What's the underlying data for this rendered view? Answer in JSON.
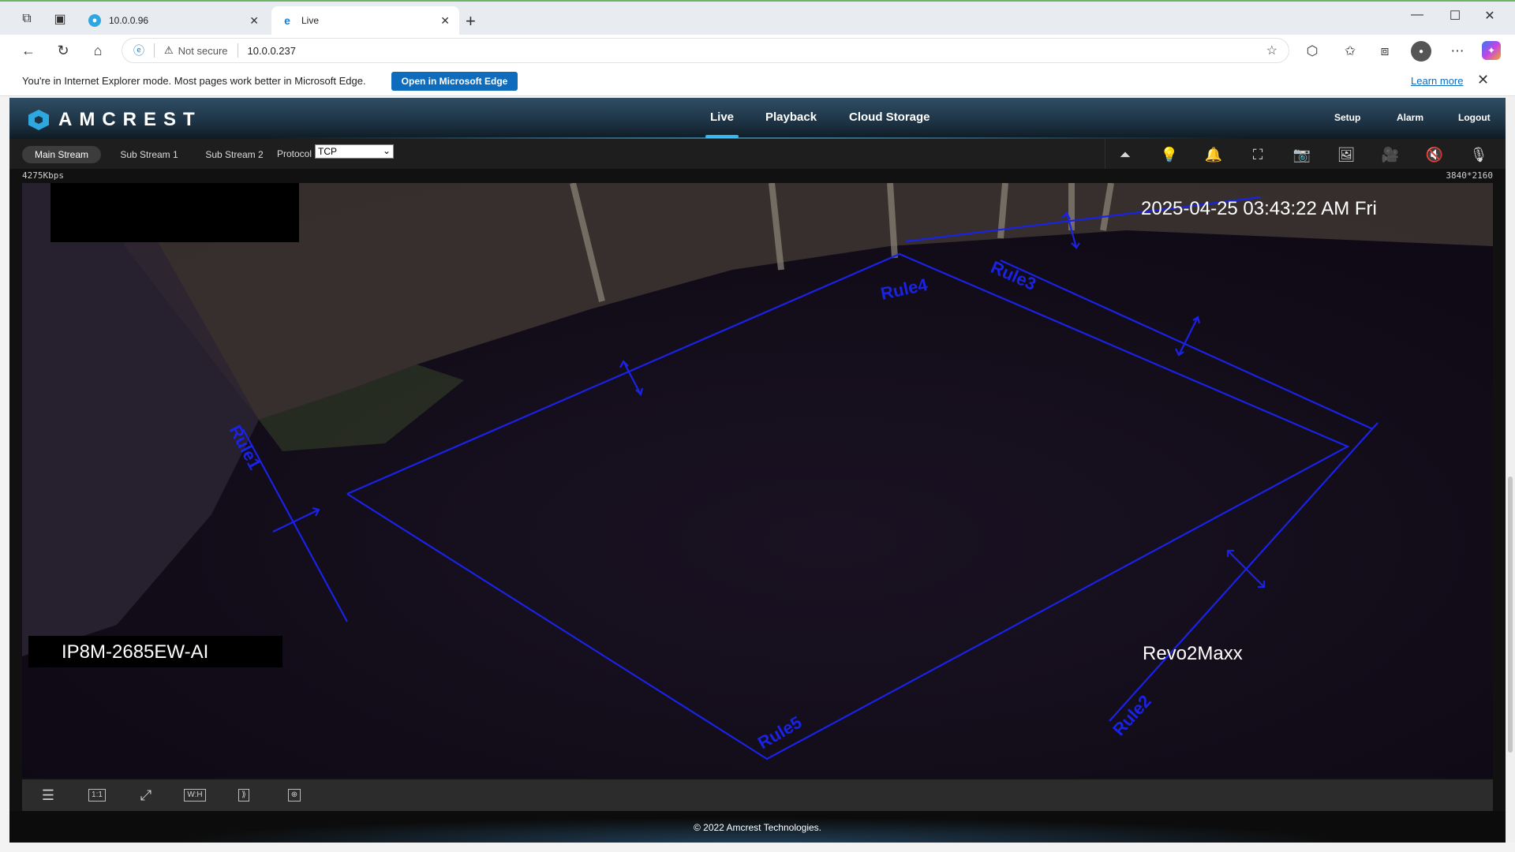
{
  "browser": {
    "tabs": [
      {
        "title": "10.0.0.96",
        "active": false
      },
      {
        "title": "Live",
        "active": true
      }
    ],
    "address": {
      "security_label": "Not secure",
      "url": "10.0.0.237"
    },
    "ie_mode_bar": {
      "message": "You're in Internet Explorer mode. Most pages work better in Microsoft Edge.",
      "open_button": "Open in Microsoft Edge",
      "learn_more": "Learn more"
    }
  },
  "app": {
    "brand": "AMCREST",
    "nav": [
      "Live",
      "Playback",
      "Cloud Storage"
    ],
    "active_nav": "Live",
    "right_nav": [
      "Setup",
      "Alarm",
      "Logout"
    ],
    "streams": [
      "Main Stream",
      "Sub Stream 1",
      "Sub Stream 2"
    ],
    "active_stream": "Main Stream",
    "protocol_label": "Protocol",
    "protocol_value": "TCP",
    "toolbar_icons": [
      "siren-icon",
      "light-icon",
      "bell-icon",
      "region-zoom-icon",
      "camera-icon",
      "image-icon",
      "record-icon",
      "mute-icon",
      "microphone-icon"
    ],
    "bitrate": "4275Kbps",
    "resolution": "3840*2160",
    "video": {
      "timestamp": "2025-04-25 03:43:22 AM Fri",
      "camera_model": "IP8M-2685EW-AI",
      "channel_name": "Revo2Maxx",
      "rules": [
        "Rule1",
        "Rule2",
        "Rule3",
        "Rule4",
        "Rule5"
      ]
    },
    "bottom_controls": [
      {
        "name": "adjust-icon",
        "label": ""
      },
      {
        "name": "original-size-icon",
        "label": "1:1"
      },
      {
        "name": "fullscreen-icon",
        "label": ""
      },
      {
        "name": "aspect-ratio-icon",
        "label": "W:H"
      },
      {
        "name": "fluency-icon",
        "label": ""
      },
      {
        "name": "ivs-rules-icon",
        "label": ""
      }
    ],
    "footer": "© 2022 Amcrest Technologies."
  },
  "colors": {
    "rule_lines": "#1a22e6",
    "accent": "#34b6f0",
    "nav_bg": "#1d3344"
  }
}
